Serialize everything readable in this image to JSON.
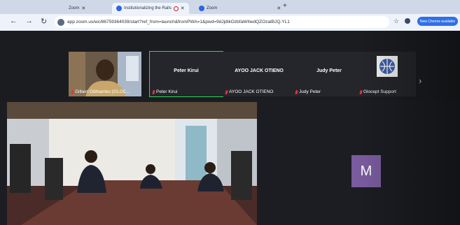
{
  "browser": {
    "tabs": [
      {
        "title": "Zoom",
        "active": false
      },
      {
        "title": "Institutionalizing the Rails",
        "active": true
      },
      {
        "title": "Zoom",
        "active": false
      }
    ],
    "address": "app.zoom.us/wc/86759364039/start?ref_from=launch&fromPWA=1&pwd=9dJjdtkOzbfaWIIwdQZOzaIBJQ.YL1",
    "relaunch_label": "New Chrome available"
  },
  "zoom": {
    "participants": [
      {
        "name": "Gilbert Odhiambo (GLOC...",
        "has_video": true
      },
      {
        "name": "Peter Kirui",
        "display_name": "Peter Kirui",
        "speaking": true
      },
      {
        "name": "AYOO JACK OTIENO",
        "display_name": "AYOO JACK OTIENO"
      },
      {
        "name": "Judy Peter",
        "display_name": "Judy Peter"
      },
      {
        "name": "Glocept Support",
        "has_logo": true
      }
    ],
    "self_avatar_letter": "M"
  },
  "colors": {
    "tab_recording": "#d21b2d",
    "active_speaker_border": "#2fd65a",
    "avatar_bg": "#7a5c9e",
    "chrome_button": "#2f6fe8"
  }
}
